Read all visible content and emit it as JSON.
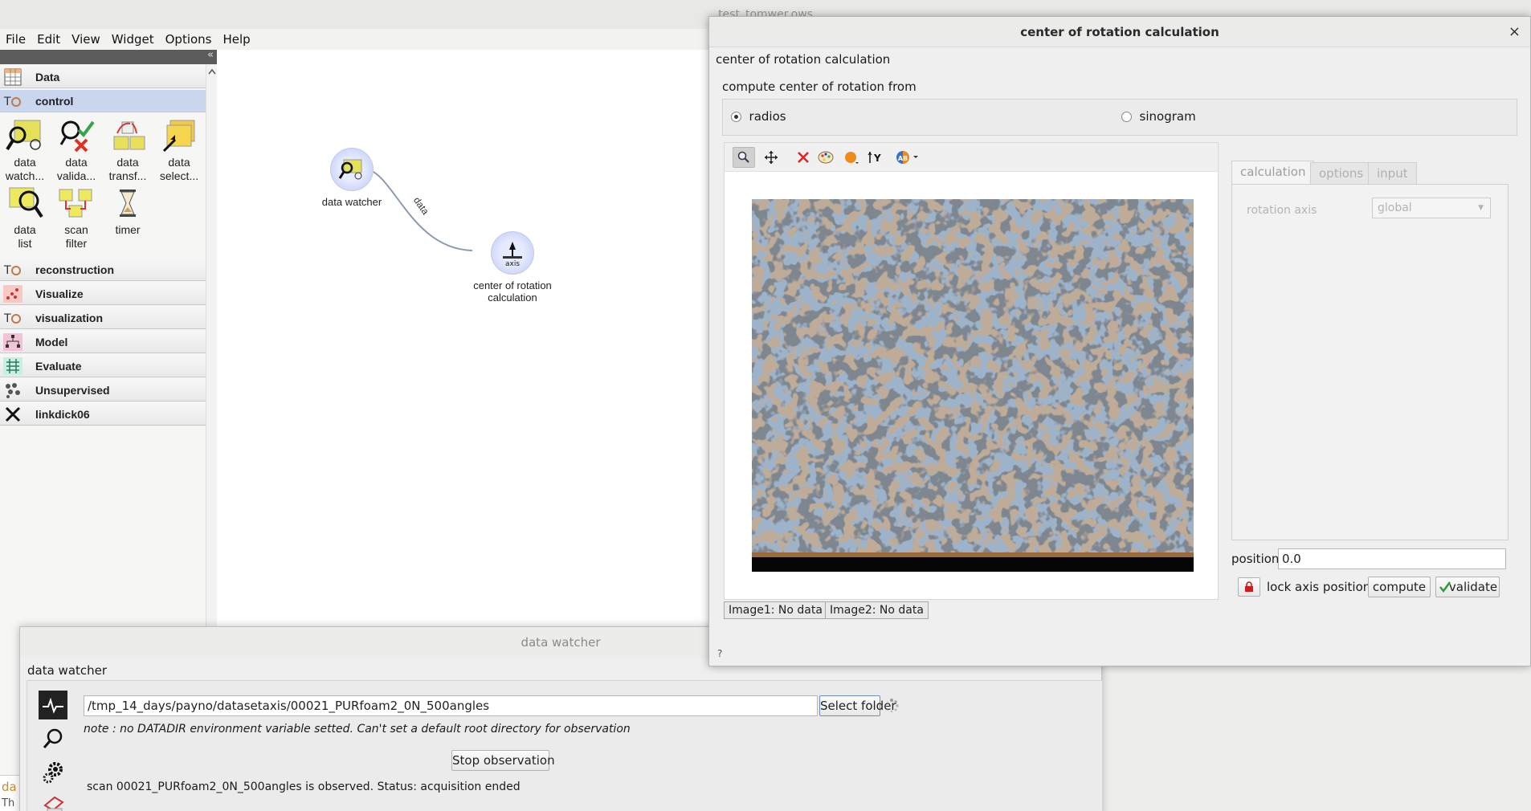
{
  "main_window": {
    "title": "test_tomwer.ows"
  },
  "menubar": [
    {
      "label": "File"
    },
    {
      "label": "Edit"
    },
    {
      "label": "View"
    },
    {
      "label": "Widget"
    },
    {
      "label": "Options"
    },
    {
      "label": "Help"
    }
  ],
  "toolbox": {
    "collapse_glyph": "«",
    "categories": {
      "data": "Data",
      "control": "control",
      "reconstruction": "reconstruction",
      "visualize": "Visualize",
      "visualization": "visualization",
      "model": "Model",
      "evaluate": "Evaluate",
      "unsupervised": "Unsupervised",
      "linkdick": "linkdick06"
    },
    "tools": {
      "data_watcher": [
        "data",
        "watch..."
      ],
      "data_validator": [
        "data",
        "valida..."
      ],
      "data_transfer": [
        "data",
        "transf..."
      ],
      "data_selector": [
        "data",
        "select..."
      ],
      "data_list": [
        "data",
        "list"
      ],
      "scan_filter": [
        "scan",
        "filter"
      ],
      "timer": [
        "timer"
      ]
    }
  },
  "canvas": {
    "nodes": {
      "data_watcher": {
        "label": "data watcher"
      },
      "center_of_rotation": {
        "label": [
          "center of rotation",
          "calculation"
        ],
        "icon_text": "axis"
      }
    },
    "link_label": "data"
  },
  "rotation_dialog": {
    "title": "center of rotation calculation",
    "close_glyph": "×",
    "header": "center of rotation calculation",
    "compute_from_label": "compute center of rotation from",
    "radio_radios": "radios",
    "radio_sinogram": "sinogram",
    "selected_source": "radios",
    "image1_status": "Image1: No data",
    "image2_status": "Image2: No data",
    "tabs": {
      "calculation": "calculation",
      "options": "options",
      "input": "input"
    },
    "active_tab": "calculation",
    "rotation_axis_label": "rotation axis",
    "rotation_axis_value": "global",
    "position_label": "position",
    "position_value": "0.0",
    "lock_label": "lock axis position",
    "compute_button": "compute",
    "validate_button": "validate",
    "help_glyph": "?",
    "colors": {
      "image_gray": "#7e8690",
      "image_fibre_blue": "#5f7fa4",
      "image_fibre_orange": "#9a7352",
      "accent_lock": "#d11a1a"
    }
  },
  "watcher_dialog": {
    "title": "data watcher",
    "header": "data watcher",
    "folder_path": "/tmp_14_days/payno/datasetaxis/00021_PURfoam2_0N_500angles",
    "select_folder_button": "Select folder",
    "note": "note : no DATADIR environment variable setted. Can't set a default root directory for observation",
    "stop_button": "Stop observation",
    "status_line": "scan 00021_PURfoam2_0N_500angles is observed. Status: acquisition ended",
    "side_icons": [
      "pulse-icon",
      "search-icon",
      "gears-icon",
      "stamp-icon"
    ]
  },
  "background_fragment": {
    "text1": "da",
    "text2": "Th"
  }
}
